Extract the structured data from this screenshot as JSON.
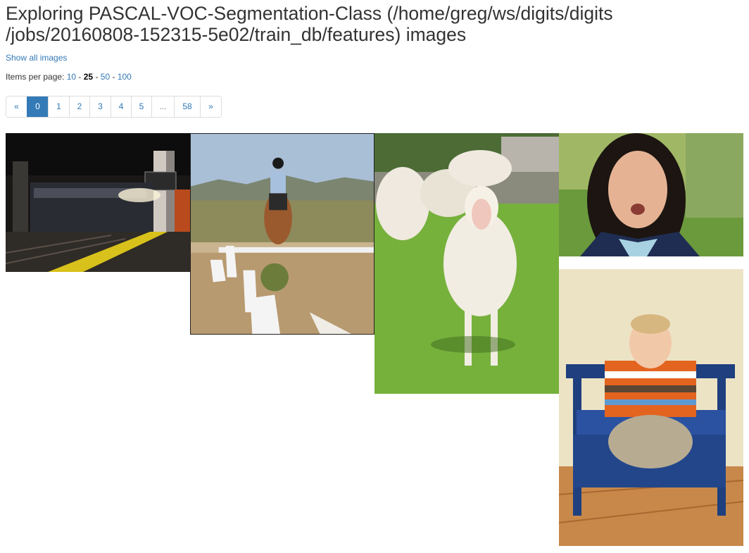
{
  "page": {
    "title": "Exploring PASCAL-VOC-Segmentation-Class (/home/greg/ws/digits/digits /jobs/20160808-152315-5e02/train_db/features) images",
    "show_all_label": "Show all images"
  },
  "per_page": {
    "label": "Items per page: ",
    "options": [
      "10",
      "25",
      "50",
      "100"
    ],
    "separator": " - ",
    "selected": "25"
  },
  "pagination": {
    "prev": "«",
    "pages": [
      "0",
      "1",
      "2",
      "3",
      "4",
      "5",
      "...",
      "58"
    ],
    "next": "»",
    "active": "0"
  },
  "images": [
    {
      "subject": "train at night station platform"
    },
    {
      "subject": "rider on horse in dressage arena"
    },
    {
      "subject": "sheep in grass field"
    },
    {
      "subject": "smiling woman portrait"
    },
    {
      "subject": "baby sitting on blue bench"
    }
  ]
}
